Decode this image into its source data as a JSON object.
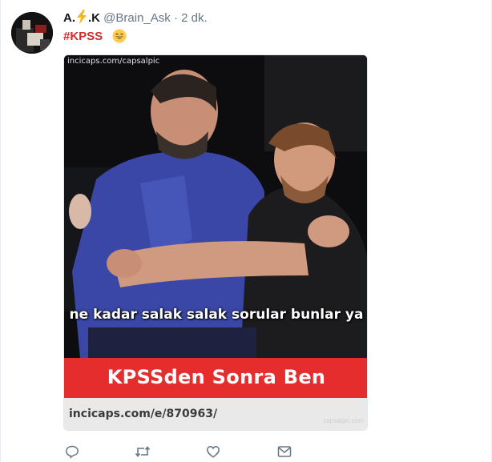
{
  "tweet": {
    "author": {
      "name_first": "A.",
      "name_second": ".K",
      "handle": "@Brain_Ask",
      "separator": "·",
      "time": "2 dk."
    },
    "hashtag": "#KPSS",
    "emoji": "grinning-face-emoji",
    "media": {
      "watermark_top": "incicaps.com/capsalpic",
      "caption": "ne kadar salak salak sorular bunlar ya",
      "banner": "KPSSden Sonra Ben",
      "footer_url": "incicaps.com/e/870963/",
      "footer_watermark": "capsalpic.com"
    },
    "actions": [
      "reply-icon",
      "retweet-icon",
      "like-icon",
      "direct-message-icon"
    ]
  },
  "colors": {
    "hashtag": "#d42a2a",
    "banner": "#e52d2d",
    "action_icon": "#657786",
    "handle": "#657786"
  }
}
